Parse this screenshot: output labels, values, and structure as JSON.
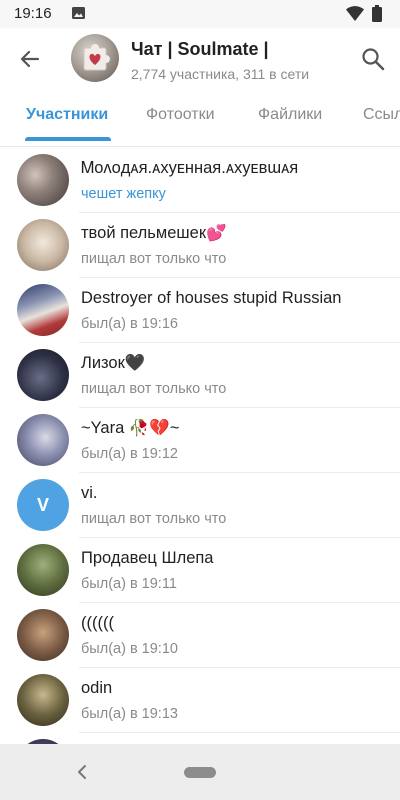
{
  "status_bar": {
    "time": "19:16",
    "icons": [
      "image-icon",
      "wifi-icon",
      "battery-icon"
    ]
  },
  "header": {
    "title": "Чат | Soulmate |",
    "subtitle": "2,774 участника, 311 в сети",
    "icons": [
      "back-arrow-icon",
      "search-icon"
    ]
  },
  "tabs": [
    {
      "label": "Участники",
      "active": true
    },
    {
      "label": "Фотоотки",
      "active": false
    },
    {
      "label": "Файлики",
      "active": false
    },
    {
      "label": "Ссылки",
      "active": false
    }
  ],
  "colors": {
    "accent": "#3a95d6",
    "secondary_text": "#8a8a8a",
    "primary_text": "#222222",
    "letter_avatar": "#4fa3e3"
  },
  "members": [
    {
      "name": "Ꮇᴏᴧᴏдᴀя.ᴀхуᴇнная.ᴀхуᴇʙɯᴀя",
      "status": "чешет жепку",
      "online": true,
      "avatar": "photo"
    },
    {
      "name": "твой пельмешек💕",
      "status": "пищал вот только что",
      "online": false,
      "avatar": "photo"
    },
    {
      "name": "Destroyer of houses stupid Russian",
      "status": "был(а) в 19:16",
      "online": false,
      "avatar": "photo"
    },
    {
      "name": "Лизок🖤",
      "status": "пищал вот только что",
      "online": false,
      "avatar": "photo"
    },
    {
      "name": "~Yara 🥀💔~",
      "status": "был(а) в 19:12",
      "online": false,
      "avatar": "photo"
    },
    {
      "name": "vi.",
      "status": "пищал вот только что",
      "online": false,
      "avatar": "letter",
      "letter": "V"
    },
    {
      "name": "Продавец Шлепа",
      "status": "был(а) в 19:11",
      "online": false,
      "avatar": "photo"
    },
    {
      "name": "((((((",
      "status": "был(а) в 19:10",
      "online": false,
      "avatar": "photo"
    },
    {
      "name": "odin",
      "status": "был(а) в 19:13",
      "online": false,
      "avatar": "photo"
    }
  ]
}
